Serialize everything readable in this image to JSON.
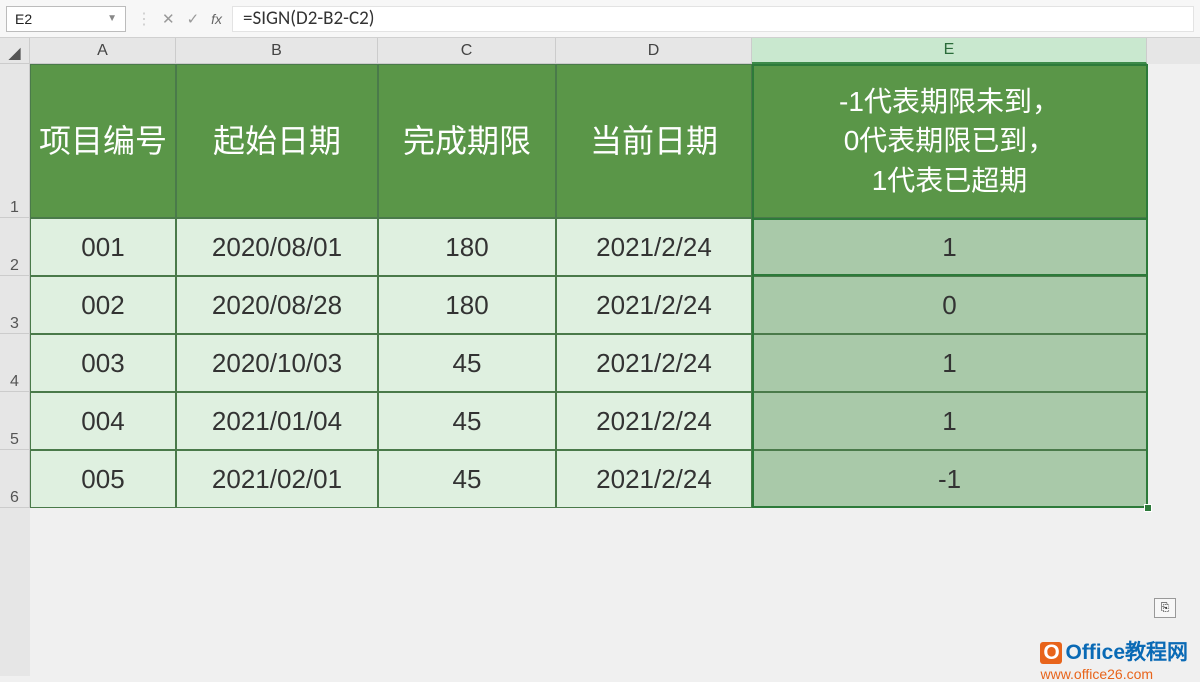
{
  "formula_bar": {
    "cell_ref": "E2",
    "formula": "=SIGN(D2-B2-C2)"
  },
  "columns": {
    "A": "A",
    "B": "B",
    "C": "C",
    "D": "D",
    "E": "E"
  },
  "row_nums": {
    "r1": "1",
    "r2": "2",
    "r3": "3",
    "r4": "4",
    "r5": "5",
    "r6": "6"
  },
  "headers": {
    "A": "项目编号",
    "B": "起始日期",
    "C": "完成期限",
    "D": "当前日期",
    "E": "-1代表期限未到，\n0代表期限已到，\n1代表已超期"
  },
  "rows": [
    {
      "A": "001",
      "B": "2020/08/01",
      "C": "180",
      "D": "2021/2/24",
      "E": "1"
    },
    {
      "A": "002",
      "B": "2020/08/28",
      "C": "180",
      "D": "2021/2/24",
      "E": "0"
    },
    {
      "A": "003",
      "B": "2020/10/03",
      "C": "45",
      "D": "2021/2/24",
      "E": "1"
    },
    {
      "A": "004",
      "B": "2021/01/04",
      "C": "45",
      "D": "2021/2/24",
      "E": "1"
    },
    {
      "A": "005",
      "B": "2021/02/01",
      "C": "45",
      "D": "2021/2/24",
      "E": "-1"
    }
  ],
  "watermark": {
    "line1": "Office教程网",
    "line2": "www.office26.com"
  }
}
